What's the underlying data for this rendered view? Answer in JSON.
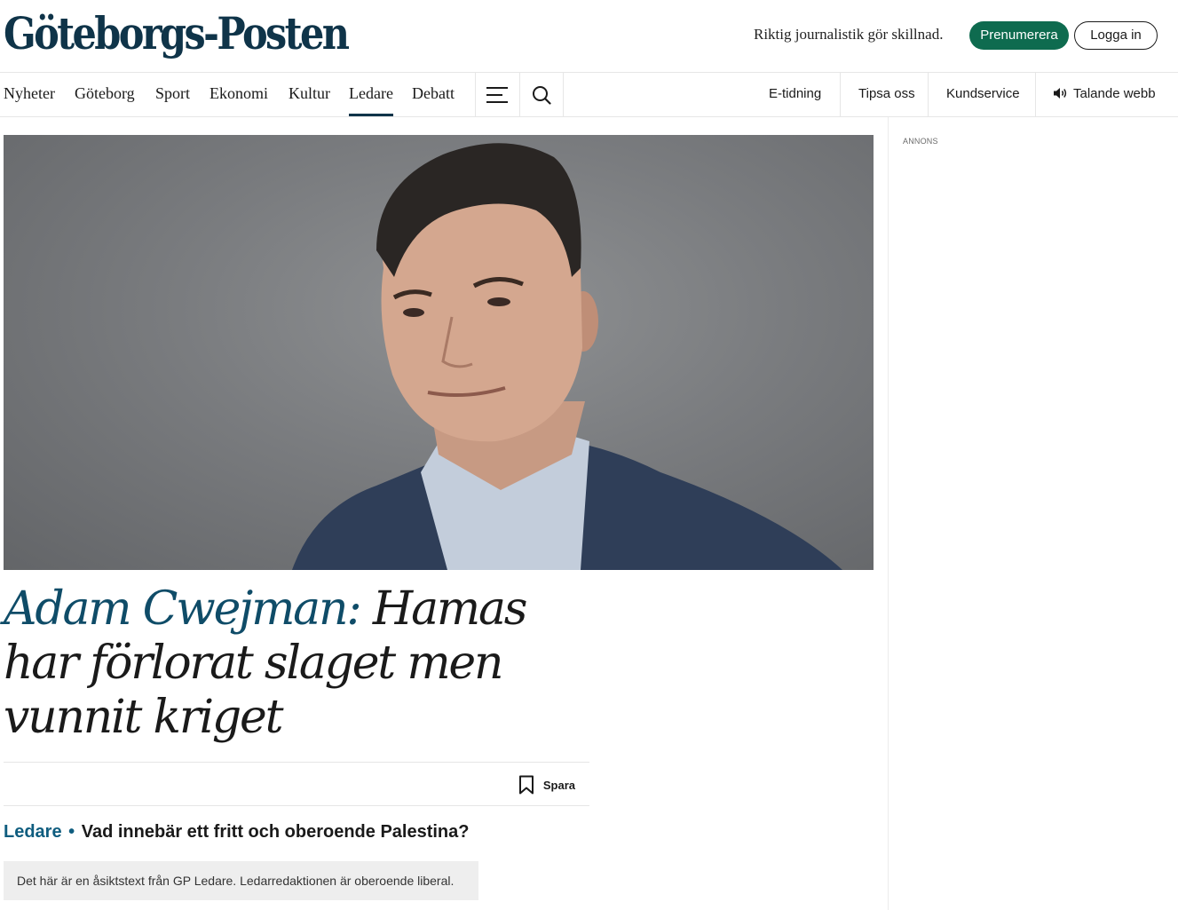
{
  "header": {
    "logo": "Göteborgs-Posten",
    "slogan": "Riktig journalistik gör skillnad.",
    "subscribe_label": "Prenumerera",
    "login_label": "Logga in"
  },
  "nav": {
    "sections": [
      {
        "label": "Nyheter"
      },
      {
        "label": "Göteborg"
      },
      {
        "label": "Sport"
      },
      {
        "label": "Ekonomi"
      },
      {
        "label": "Kultur"
      },
      {
        "label": "Ledare",
        "active": true
      },
      {
        "label": "Debatt"
      }
    ],
    "menu_icon": "hamburger-menu-icon",
    "search_icon": "search-icon",
    "utilities": [
      {
        "label": "E-tidning"
      },
      {
        "label": "Tipsa oss"
      },
      {
        "label": "Kundservice"
      },
      {
        "label": "Talande webb",
        "icon": "speaker-icon"
      }
    ]
  },
  "sidebar": {
    "ad_label": "ANNONS"
  },
  "article": {
    "headline_author": "Adam Cwejman:",
    "headline_text": " Hamas har förlorat slaget men vunnit kriget",
    "save_label": "Spara",
    "section": "Ledare",
    "separator": "•",
    "subtitle": "Vad innebär ett fritt och oberoende Palestina?",
    "disclaimer": "Det här är en åsiktstext från GP Ledare. Ledarredaktionen är oberoende liberal."
  },
  "colors": {
    "brand_navy": "#0f3449",
    "subscribe_green": "#0e6b4f",
    "section_blue": "#0f5d7f"
  }
}
